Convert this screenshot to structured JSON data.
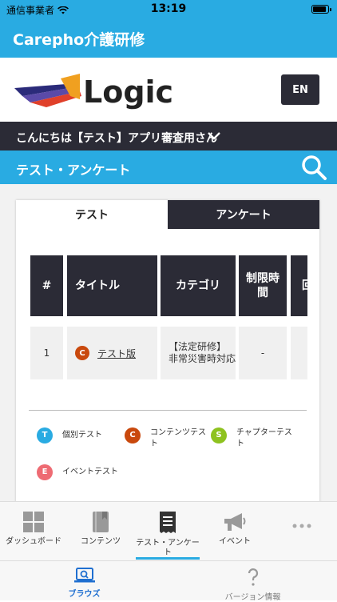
{
  "status_bar": {
    "carrier": "通信事業者",
    "time": "13:19"
  },
  "app_title": "Carepho介護研修",
  "language_button": "EN",
  "greeting": "こんにちは【テスト】アプリ審査用さん",
  "section_title": "テスト・アンケート",
  "tabs": [
    {
      "label": "テスト"
    },
    {
      "label": "アンケート"
    }
  ],
  "table": {
    "headers": [
      "#",
      "タイトル",
      "カテゴリ",
      "制限時間",
      "回"
    ],
    "rows": [
      {
        "num": "1",
        "badge": "C",
        "title": "テスト版",
        "category": "【法定研修】\n非常災害時対応",
        "time_limit": "-"
      }
    ]
  },
  "legend": [
    {
      "badge": "T",
      "label": "個別テスト",
      "color": "#29abe2"
    },
    {
      "badge": "C",
      "label": "コンテンツテスト",
      "color": "#c9490d"
    },
    {
      "badge": "S",
      "label": "チャプターテスト",
      "color": "#8ec21f"
    },
    {
      "badge": "E",
      "label": "イベントテスト",
      "color": "#ee6b73"
    }
  ],
  "tabbar": [
    {
      "label": "ダッシュボード",
      "icon": "dashboard-icon"
    },
    {
      "label": "コンテンツ",
      "icon": "book-icon"
    },
    {
      "label": "テスト・アンケート",
      "icon": "receipt-icon"
    },
    {
      "label": "イベント",
      "icon": "megaphone-icon"
    },
    {
      "label": "",
      "icon": "more-icon"
    }
  ],
  "bottom_nav": [
    {
      "label": "ブラウズ",
      "icon": "browse-icon"
    },
    {
      "label": "バージョン情報",
      "icon": "question-icon"
    }
  ],
  "colors": {
    "accent": "#29abe2",
    "dark": "#2b2b36",
    "content_badge": "#c9490d"
  }
}
